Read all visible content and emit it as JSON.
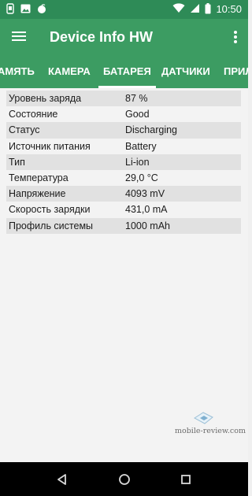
{
  "status_bar": {
    "time": "10:50",
    "icons": [
      "notification-icon",
      "image-icon",
      "app-icon",
      "wifi-icon",
      "signal-icon",
      "battery-icon"
    ]
  },
  "app_bar": {
    "title": "Device Info HW",
    "menu_icon": "hamburger-menu-icon",
    "overflow_icon": "more-vert-icon"
  },
  "tabs": [
    {
      "label": "АМЯТЬ",
      "active": false
    },
    {
      "label": "КАМЕРА",
      "active": false
    },
    {
      "label": "БАТАРЕЯ",
      "active": true
    },
    {
      "label": "ДАТЧИКИ",
      "active": false
    },
    {
      "label": "ПРИЛ",
      "active": false
    }
  ],
  "battery_info": {
    "rows": [
      {
        "label": "Уровень заряда",
        "value": "87 %"
      },
      {
        "label": "Состояние",
        "value": "Good"
      },
      {
        "label": "Статус",
        "value": "Discharging"
      },
      {
        "label": "Источник питания",
        "value": "Battery"
      },
      {
        "label": "Тип",
        "value": "Li-ion"
      },
      {
        "label": "Температура",
        "value": "29,0 °C"
      },
      {
        "label": "Напряжение",
        "value": "4093 mV"
      },
      {
        "label": "Скорость зарядки",
        "value": "431,0 mA"
      },
      {
        "label": "Профиль системы",
        "value": "1000 mAh"
      }
    ]
  },
  "watermark": {
    "text": "mobile-review.com"
  },
  "nav_bar": {
    "buttons": [
      "back-icon",
      "home-icon",
      "recents-icon"
    ]
  },
  "colors": {
    "status_bar": "#2e8b57",
    "app_bar": "#3c9c62",
    "shaded_row": "#e1e1e1",
    "background": "#f3f3f3"
  }
}
